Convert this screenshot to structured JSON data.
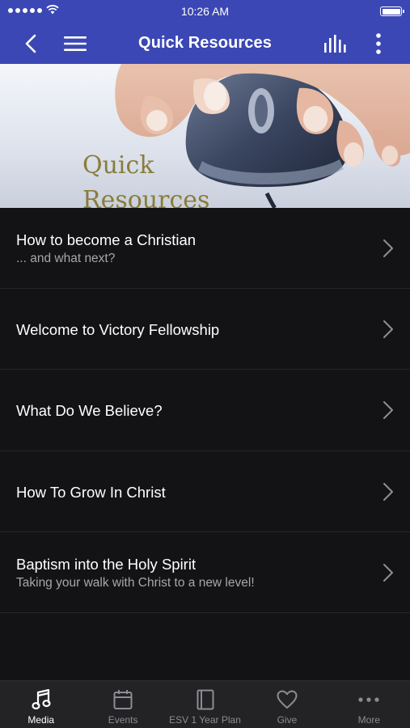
{
  "status_bar": {
    "time": "10:26 AM"
  },
  "nav": {
    "title": "Quick Resources"
  },
  "banner": {
    "line1": "Quick",
    "line2": "Resources"
  },
  "list": [
    {
      "title": "How to become a Christian",
      "subtitle": "... and what next?"
    },
    {
      "title": "Welcome to Victory Fellowship",
      "subtitle": ""
    },
    {
      "title": "What Do We Believe?",
      "subtitle": ""
    },
    {
      "title": "How To Grow In Christ",
      "subtitle": ""
    },
    {
      "title": "Baptism into the Holy Spirit",
      "subtitle": "Taking your walk with Christ to a new level!"
    }
  ],
  "tabs": [
    {
      "label": "Media",
      "icon": "music-note-icon",
      "active": true
    },
    {
      "label": "Events",
      "icon": "calendar-icon",
      "active": false
    },
    {
      "label": "ESV 1 Year Plan",
      "icon": "book-icon",
      "active": false
    },
    {
      "label": "Give",
      "icon": "heart-icon",
      "active": false
    },
    {
      "label": "More",
      "icon": "more-dots-icon",
      "active": false
    }
  ],
  "colors": {
    "header": "#3b47b4",
    "background": "#131315",
    "tabbar": "#232326",
    "banner_text": "#8a7d3a"
  }
}
